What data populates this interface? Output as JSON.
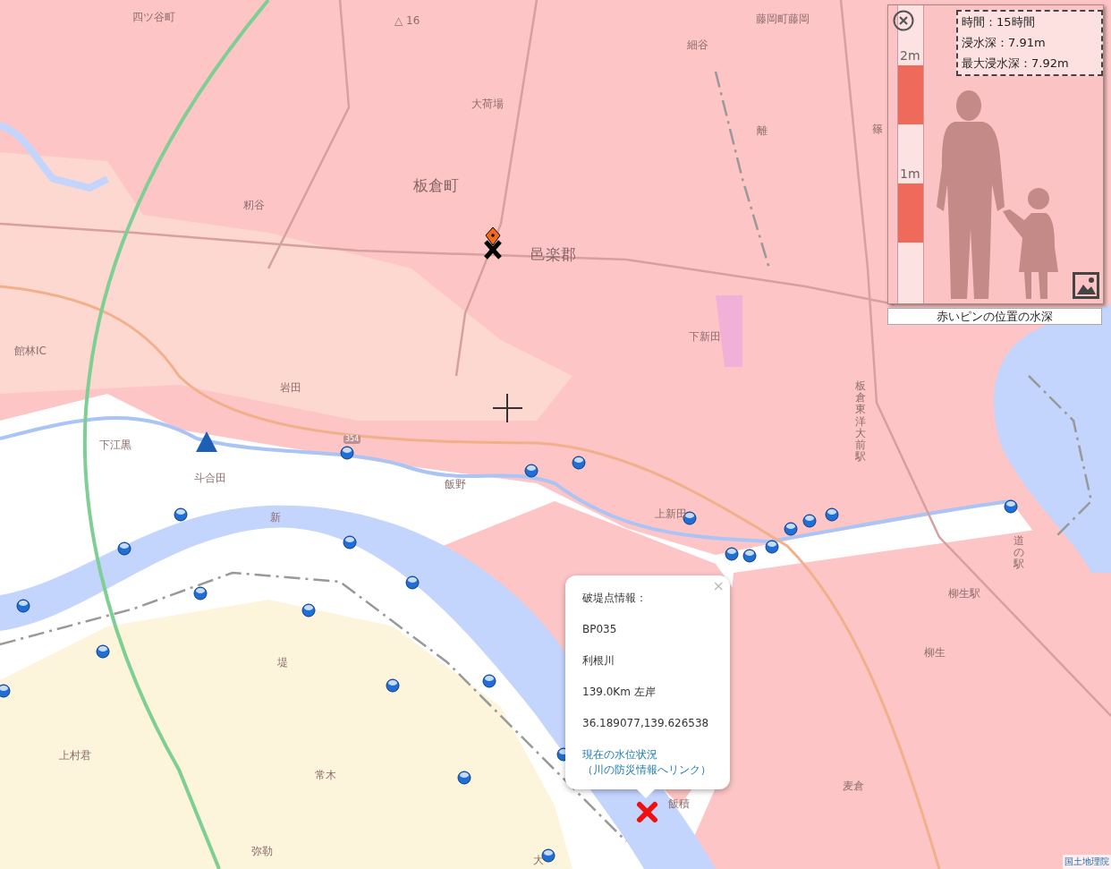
{
  "map": {
    "labels": [
      {
        "text": "四ツ谷町",
        "kind": "place"
      },
      {
        "text": "△ 16",
        "kind": "place"
      },
      {
        "text": "藤岡町藤岡",
        "kind": "place"
      },
      {
        "text": "細谷",
        "kind": "place"
      },
      {
        "text": "大荷場",
        "kind": "place"
      },
      {
        "text": "離",
        "kind": "place"
      },
      {
        "text": "篠",
        "kind": "place"
      },
      {
        "text": "板倉町",
        "kind": "large"
      },
      {
        "text": "籾谷",
        "kind": "place"
      },
      {
        "text": "邑楽郡",
        "kind": "large"
      },
      {
        "text": "下新田",
        "kind": "place"
      },
      {
        "text": "館林IC",
        "kind": "place"
      },
      {
        "text": "岩田",
        "kind": "place"
      },
      {
        "text": "板倉東洋大前駅",
        "kind": "vertical"
      },
      {
        "text": "下江黒",
        "kind": "place"
      },
      {
        "text": "斗合田",
        "kind": "place"
      },
      {
        "text": "飯野",
        "kind": "place"
      },
      {
        "text": "上新田",
        "kind": "place"
      },
      {
        "text": "新",
        "kind": "place"
      },
      {
        "text": "354",
        "kind": "shield"
      },
      {
        "text": "道の駅",
        "kind": "vertical"
      },
      {
        "text": "柳生駅",
        "kind": "place"
      },
      {
        "text": "柳生",
        "kind": "place"
      },
      {
        "text": "堤",
        "kind": "place"
      },
      {
        "text": "上村君",
        "kind": "place"
      },
      {
        "text": "常木",
        "kind": "place"
      },
      {
        "text": "麦倉",
        "kind": "place"
      },
      {
        "text": "飯積",
        "kind": "place"
      },
      {
        "text": "弥勒",
        "kind": "place"
      },
      {
        "text": "大",
        "kind": "place"
      }
    ],
    "attribution": "国土地理院"
  },
  "depth_panel": {
    "scale_labels": [
      "2m",
      "1m"
    ],
    "info": [
      "時間：15時間",
      "浸水深：7.91m",
      "最大浸水深：7.92m"
    ],
    "caption": "赤いピンの位置の水深"
  },
  "popup": {
    "close": "×",
    "lines": [
      "破堤点情報：",
      "BP035",
      "利根川",
      "139.0Km 左岸",
      "36.189077,139.626538"
    ],
    "link_lines": [
      "現在の水位状況",
      "（川の防災情報へリンク）"
    ]
  }
}
